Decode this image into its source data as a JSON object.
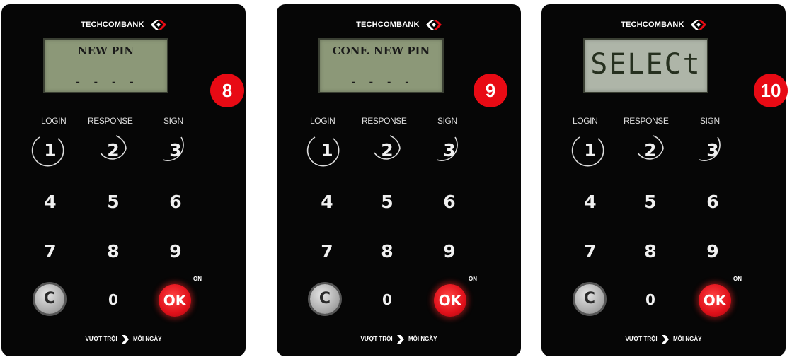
{
  "devices": [
    {
      "brand": "TECHCOMBANK",
      "screen": {
        "line1": "NEW PIN",
        "line2": "- - - -",
        "segment": ""
      },
      "labels": [
        "LOGIN",
        "RESPONSE",
        "SIGN"
      ],
      "keys": [
        "1",
        "2",
        "3",
        "4",
        "5",
        "6",
        "7",
        "8",
        "9",
        "0"
      ],
      "clear": "C",
      "ok": "OK",
      "on": "ON",
      "slogan_left": "VƯỢT TRỘI",
      "slogan_right": "MỖI NGÀY",
      "step": "8"
    },
    {
      "brand": "TECHCOMBANK",
      "screen": {
        "line1": "CONF. NEW PIN",
        "line2": "- - - -",
        "segment": ""
      },
      "labels": [
        "LOGIN",
        "RESPONSE",
        "SIGN"
      ],
      "keys": [
        "1",
        "2",
        "3",
        "4",
        "5",
        "6",
        "7",
        "8",
        "9",
        "0"
      ],
      "clear": "C",
      "ok": "OK",
      "on": "ON",
      "slogan_left": "VƯỢT TRỘI",
      "slogan_right": "MỖI NGÀY",
      "step": "9"
    },
    {
      "brand": "TECHCOMBANK",
      "screen": {
        "line1": "",
        "line2": "",
        "segment": "SELECt"
      },
      "labels": [
        "LOGIN",
        "RESPONSE",
        "SIGN"
      ],
      "keys": [
        "1",
        "2",
        "3",
        "4",
        "5",
        "6",
        "7",
        "8",
        "9",
        "0"
      ],
      "clear": "C",
      "ok": "OK",
      "on": "ON",
      "slogan_left": "VƯỢT TRỘI",
      "slogan_right": "MỖI NGÀY",
      "step": "10"
    }
  ],
  "colors": {
    "device_body": "#060606",
    "lcd_green": "#8c9878",
    "ok_red": "#e0101a",
    "badge_red": "#e80a14"
  },
  "icons": [
    "techcombank-logo-icon",
    "slogan-arrow-icon"
  ]
}
